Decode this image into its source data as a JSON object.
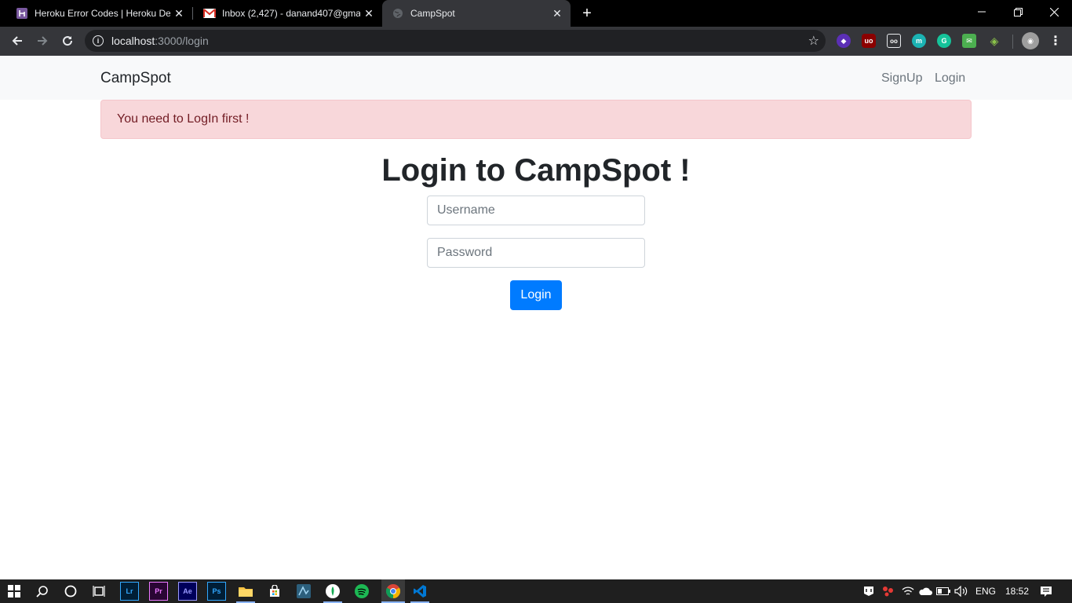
{
  "browser": {
    "tabs": [
      {
        "title": "Heroku Error Codes | Heroku Dev",
        "favicon": "heroku-icon"
      },
      {
        "title": "Inbox (2,427) - danand407@gma",
        "favicon": "gmail-icon"
      },
      {
        "title": "CampSpot",
        "favicon": "globe-icon"
      }
    ],
    "url_host": "localhost",
    "url_rest": ":3000/login"
  },
  "navbar": {
    "brand": "CampSpot",
    "links": [
      "SignUp",
      "Login"
    ]
  },
  "alert": {
    "message": "You need to LogIn first !"
  },
  "form": {
    "heading": "Login to CampSpot !",
    "username_placeholder": "Username",
    "password_placeholder": "Password",
    "submit_label": "Login"
  },
  "taskbar": {
    "apps": [
      "Lr",
      "Pr",
      "Ae",
      "Ps"
    ],
    "language": "ENG",
    "time": "18:52"
  },
  "colors": {
    "primary": "#007bff",
    "alert_bg": "#f8d7da",
    "alert_text": "#721c24",
    "navbar_bg": "#f8f9fa"
  }
}
